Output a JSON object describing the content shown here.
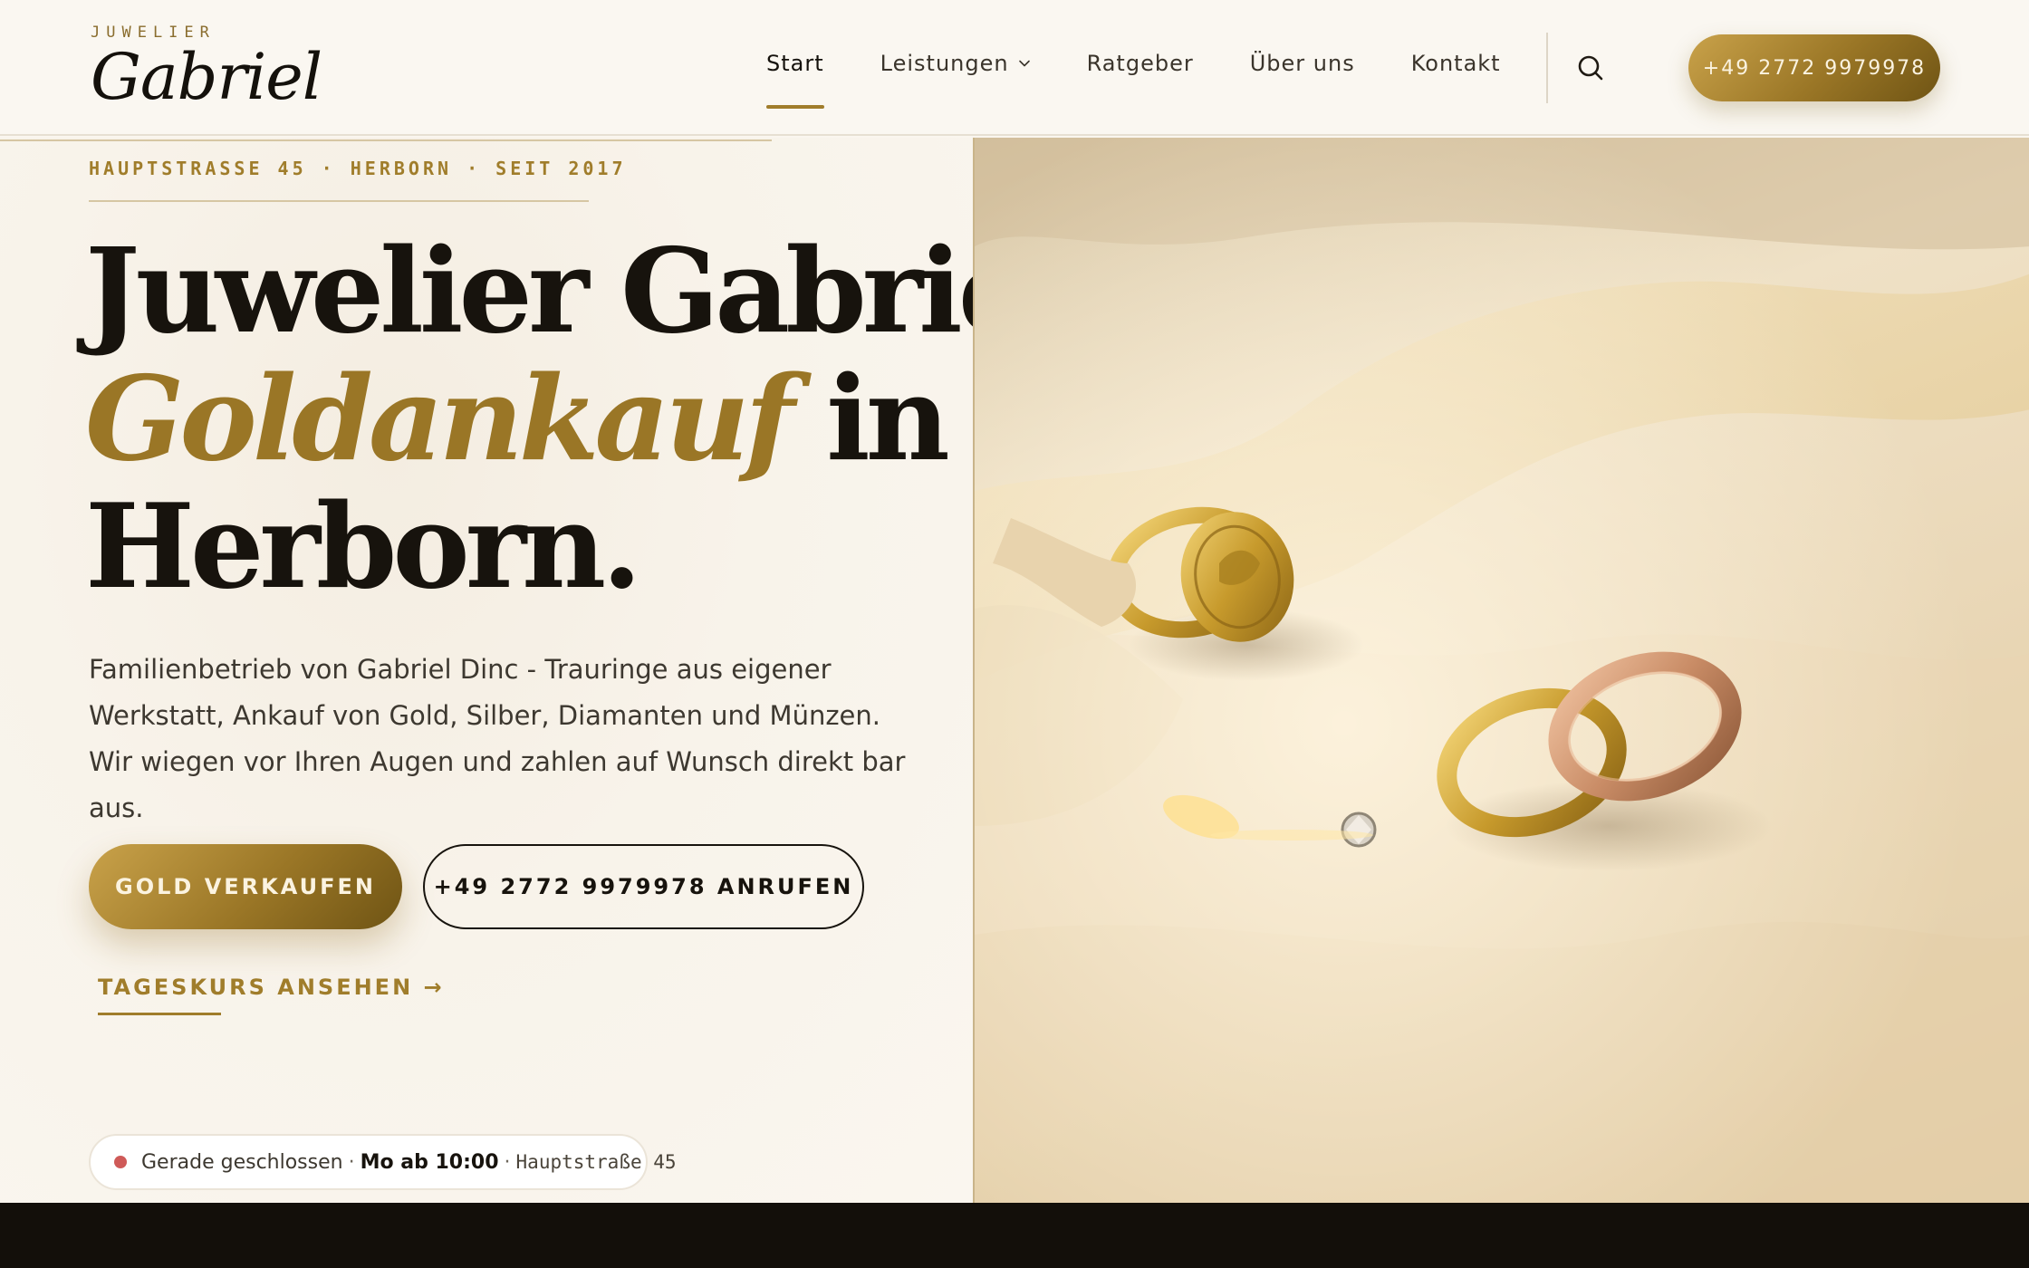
{
  "header": {
    "logo_kicker": "JUWELIER",
    "logo_name": "Gabriel",
    "nav": [
      {
        "label": "Start",
        "active": true
      },
      {
        "label": "Leistungen",
        "has_dropdown": true
      },
      {
        "label": "Ratgeber"
      },
      {
        "label": "Über uns"
      },
      {
        "label": "Kontakt"
      }
    ],
    "search_icon": "search-icon",
    "cta_phone": "+49 2772 9979978"
  },
  "hero": {
    "eyebrow": "HAUPTSTRASSE 45 · HERBORN · SEIT 2017",
    "headline_line1": "Juwelier Gabriel.",
    "headline_gold": "Goldankauf",
    "headline_line2_rest": " in",
    "headline_line3": "Herborn.",
    "lead": "Familienbetrieb von Gabriel Dinc - Trauringe aus eigener Werkstatt, Ankauf von Gold, Silber, Diamanten und Münzen. Wir wiegen vor Ihren Augen und zahlen auf Wunsch direkt bar aus.",
    "primary_button": "GOLD VERKAUFEN",
    "secondary_button": "+49 2772 9979978 ANRUFEN",
    "rate_link": "TAGESKURS ANSEHEN →",
    "status": {
      "state": "Gerade geschlossen",
      "separator": "·",
      "next_open": "Mo ab 10:00",
      "address": "Hauptstraße 45",
      "dot_color": "#cf5a58"
    }
  },
  "colors": {
    "gold": "#a07d2b",
    "dark": "#17130d",
    "background": "#faf6ef"
  }
}
